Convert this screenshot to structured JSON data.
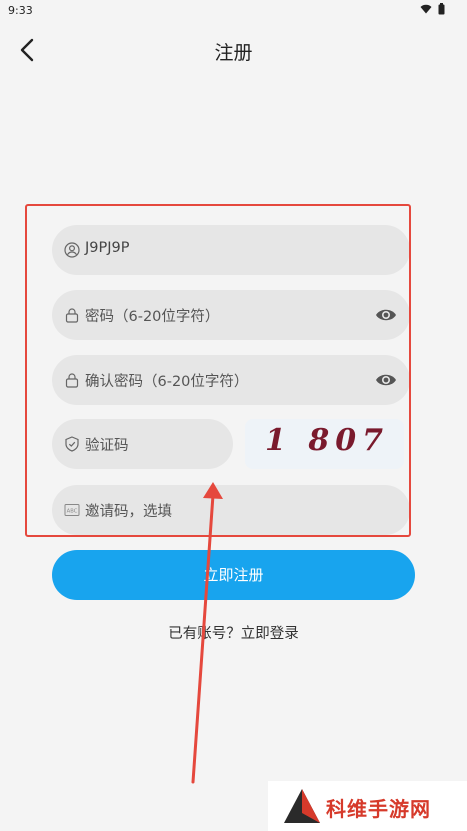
{
  "status_bar": {
    "time": "9:33"
  },
  "header": {
    "title": "注册"
  },
  "form": {
    "username_value": "J9PJ9P",
    "password_placeholder": "密码（6-20位字符）",
    "confirm_placeholder": "确认密码（6-20位字符）",
    "captcha_placeholder": "验证码",
    "captcha_code": "1 807",
    "invite_placeholder": "邀请码，选填",
    "invite_icon_label": "ABC"
  },
  "actions": {
    "submit_label": "立即注册",
    "login_link": "已有账号？立即登录"
  },
  "watermark": {
    "text": "科维手游网"
  },
  "colors": {
    "accent": "#18a4ee",
    "annotation": "#e5483d",
    "watermark": "#d63a2b"
  }
}
